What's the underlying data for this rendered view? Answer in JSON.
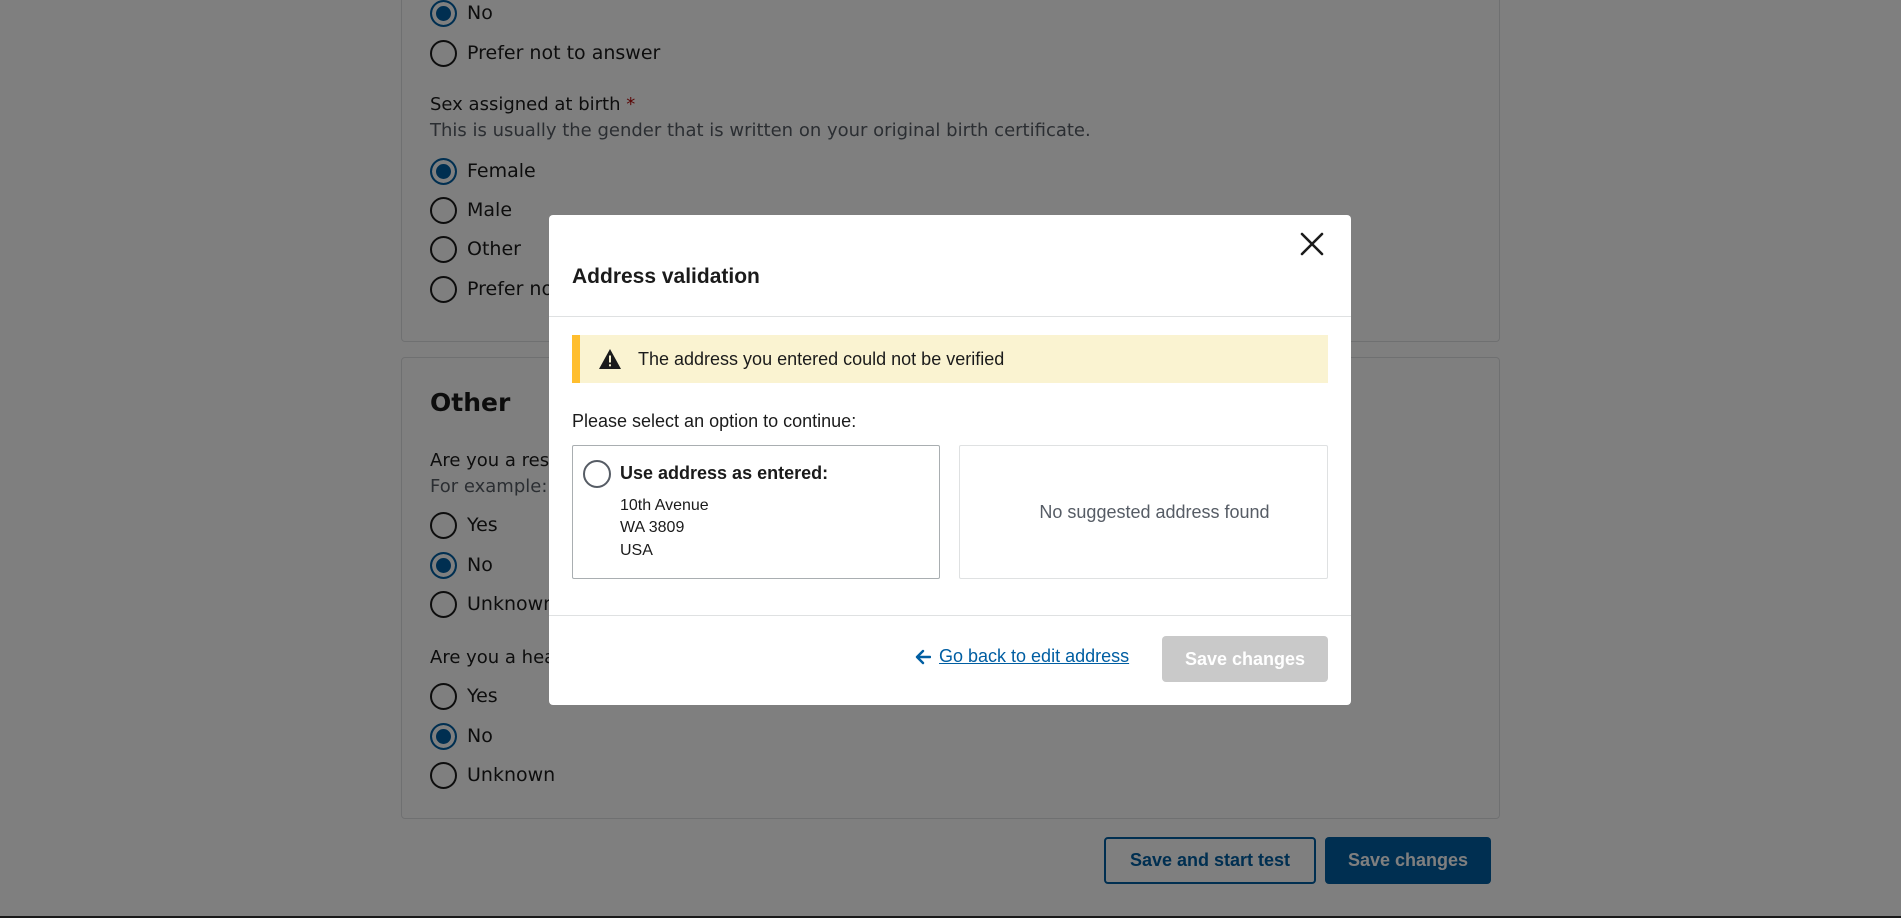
{
  "background": {
    "section1": {
      "prev_question_options": [
        {
          "label": "No",
          "checked": true
        },
        {
          "label": "Prefer not to answer",
          "checked": false
        }
      ],
      "sex_question": {
        "label": "Sex assigned at birth",
        "required_marker": "*",
        "hint": "This is usually the gender that is written on your original birth certificate.",
        "options": [
          {
            "label": "Female",
            "checked": true
          },
          {
            "label": "Male",
            "checked": false
          },
          {
            "label": "Other",
            "checked": false
          },
          {
            "label": "Prefer not",
            "checked": false
          }
        ]
      }
    },
    "section2": {
      "title": "Other",
      "resident_question": {
        "label": "Are you a resid",
        "hint": "For example: r",
        "options": [
          {
            "label": "Yes",
            "checked": false
          },
          {
            "label": "No",
            "checked": true
          },
          {
            "label": "Unknown",
            "checked": false
          }
        ]
      },
      "health_question": {
        "label": "Are you a heal",
        "options": [
          {
            "label": "Yes",
            "checked": false
          },
          {
            "label": "No",
            "checked": true
          },
          {
            "label": "Unknown",
            "checked": false
          }
        ]
      }
    },
    "footer": {
      "save_and_start_label": "Save and start test",
      "save_changes_label": "Save changes"
    }
  },
  "modal": {
    "title": "Address validation",
    "alert_text": "The address you entered could not be verified",
    "prompt": "Please select an option to continue:",
    "entered_option": {
      "heading": "Use address as entered:",
      "address_lines": [
        "10th Avenue",
        "WA 3809",
        "USA"
      ],
      "checked": false
    },
    "suggested_text": "No suggested address found",
    "back_link_label": "Go back to edit address",
    "save_label": "Save changes",
    "close_icon": "close-icon",
    "warning_icon": "warning-icon",
    "back_arrow_icon": "arrow-left-icon"
  },
  "colors": {
    "primary": "#005ea2",
    "alert_bg": "#faf3d1",
    "alert_border": "#ffbe2e",
    "disabled_btn": "#c9c9c9",
    "required": "#b50909"
  }
}
